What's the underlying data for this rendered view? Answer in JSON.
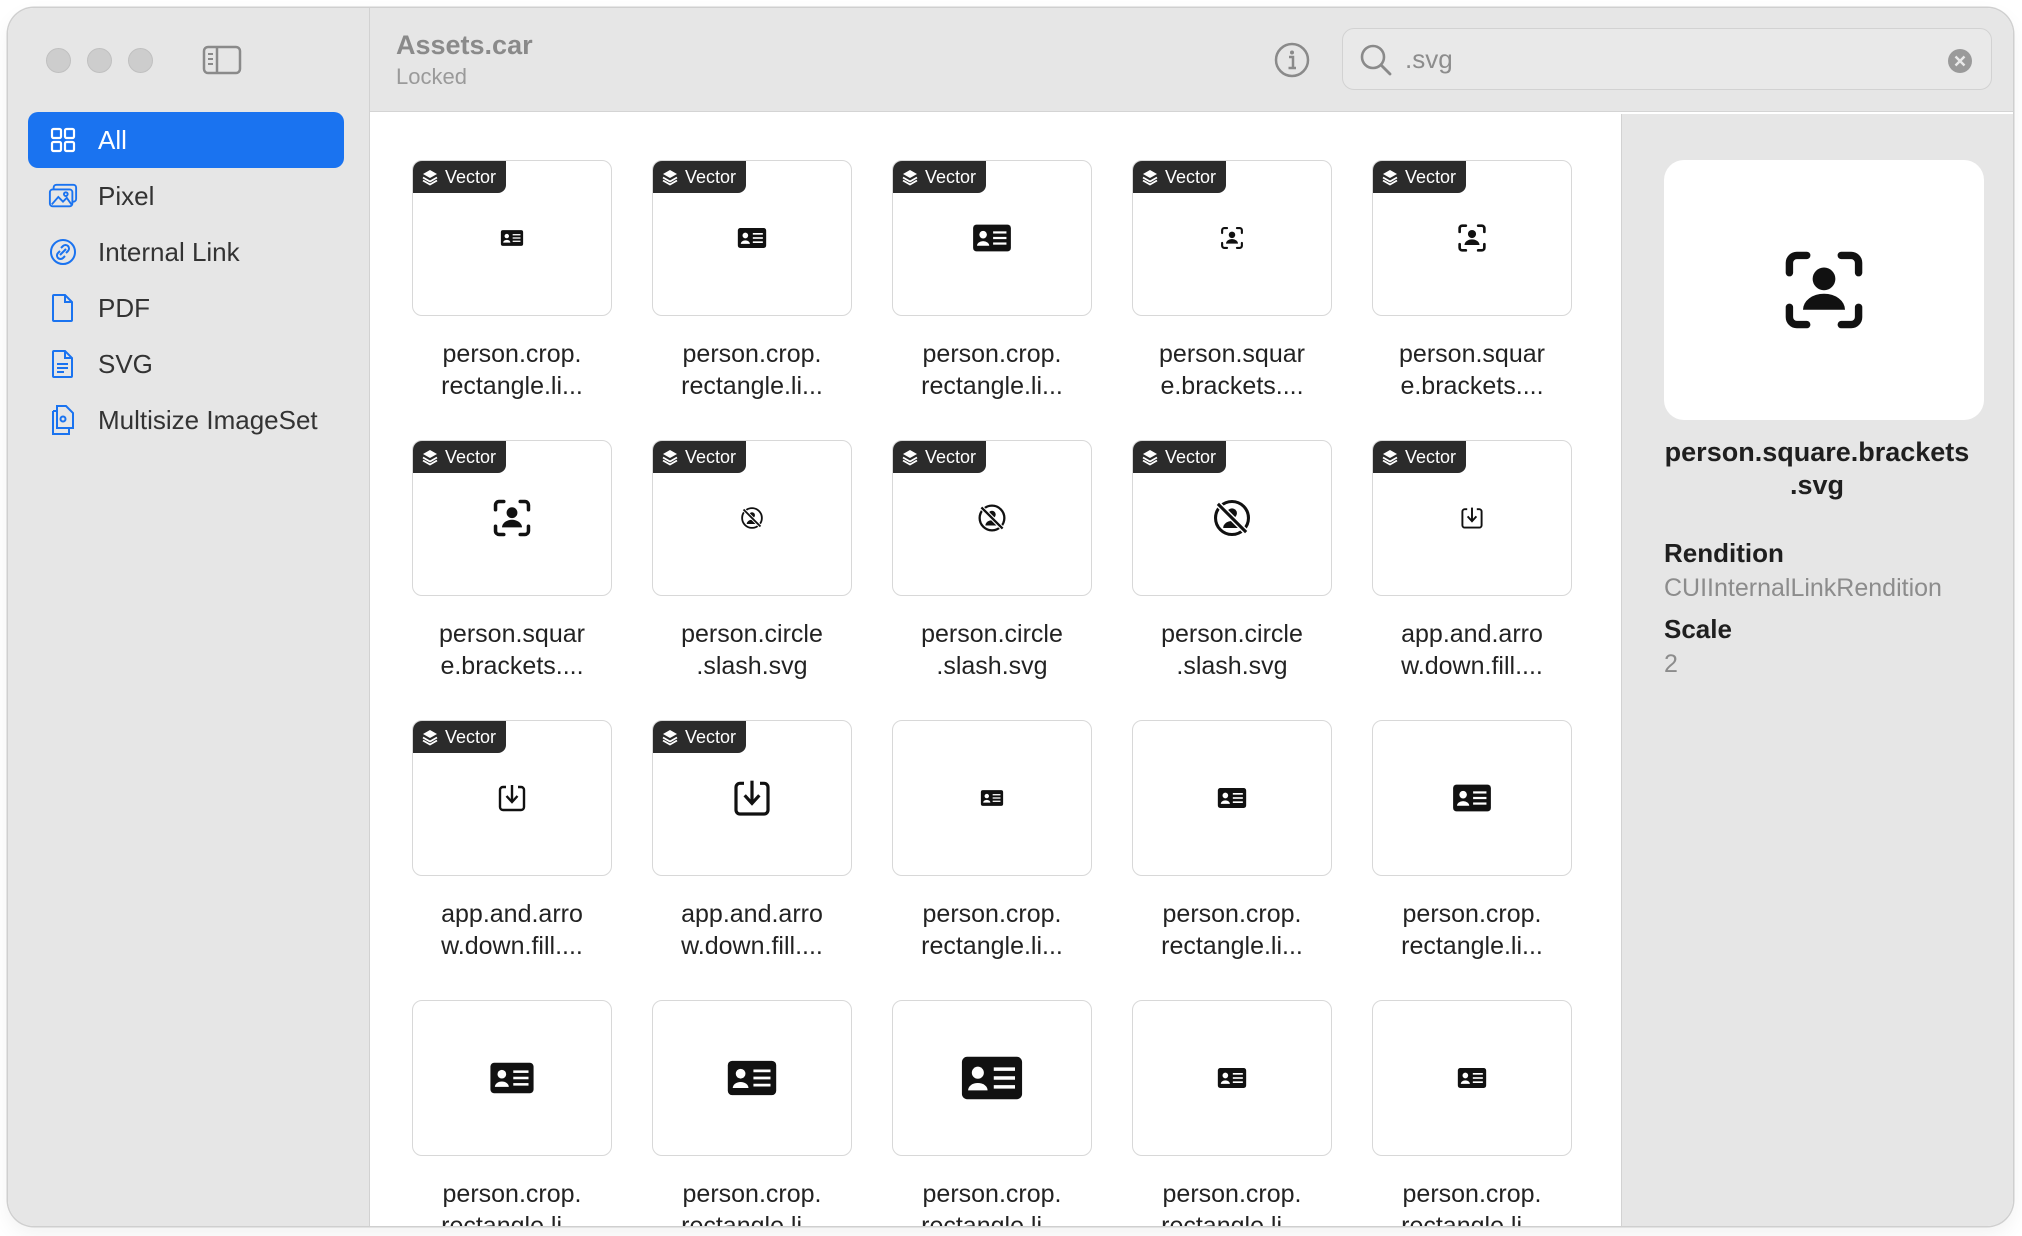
{
  "window": {
    "title": "Assets.car",
    "subtitle": "Locked"
  },
  "sidebar": {
    "items": [
      {
        "label": "All",
        "icon": "grid-icon",
        "active": true
      },
      {
        "label": "Pixel",
        "icon": "photos-icon",
        "active": false
      },
      {
        "label": "Internal Link",
        "icon": "link-icon",
        "active": false
      },
      {
        "label": "PDF",
        "icon": "document-icon",
        "active": false
      },
      {
        "label": "SVG",
        "icon": "document-text-icon",
        "active": false
      },
      {
        "label": "Multisize ImageSet",
        "icon": "documents-stack-icon",
        "active": false
      }
    ]
  },
  "search": {
    "value": ".svg",
    "placeholder": "Search"
  },
  "badge_label": "Vector",
  "assets": [
    {
      "label": "person.crop.\nrectangle.li...",
      "vector": true,
      "icon": "person-card-icon",
      "size": "xs"
    },
    {
      "label": "person.crop.\nrectangle.li...",
      "vector": true,
      "icon": "person-card-icon",
      "size": "s"
    },
    {
      "label": "person.crop.\nrectangle.li...",
      "vector": true,
      "icon": "person-card-icon",
      "size": "m"
    },
    {
      "label": "person.squar\ne.brackets....",
      "vector": true,
      "icon": "person-brackets-icon",
      "size": "xs"
    },
    {
      "label": "person.squar\ne.brackets....",
      "vector": true,
      "icon": "person-brackets-icon",
      "size": "s"
    },
    {
      "label": "person.squar\ne.brackets....",
      "vector": true,
      "icon": "person-brackets-icon",
      "size": "m"
    },
    {
      "label": "person.circle\n.slash.svg",
      "vector": true,
      "icon": "person-circle-slash-icon",
      "size": "xs"
    },
    {
      "label": "person.circle\n.slash.svg",
      "vector": true,
      "icon": "person-circle-slash-icon",
      "size": "s"
    },
    {
      "label": "person.circle\n.slash.svg",
      "vector": true,
      "icon": "person-circle-slash-icon",
      "size": "m"
    },
    {
      "label": "app.and.arro\nw.down.fill....",
      "vector": true,
      "icon": "app-arrow-down-icon",
      "size": "xs"
    },
    {
      "label": "app.and.arro\nw.down.fill....",
      "vector": true,
      "icon": "app-arrow-down-icon",
      "size": "s"
    },
    {
      "label": "app.and.arro\nw.down.fill....",
      "vector": true,
      "icon": "app-arrow-down-icon",
      "size": "m"
    },
    {
      "label": "person.crop.\nrectangle.li...",
      "vector": false,
      "icon": "person-card-icon",
      "size": "xs"
    },
    {
      "label": "person.crop.\nrectangle.li...",
      "vector": false,
      "icon": "person-card-icon",
      "size": "s"
    },
    {
      "label": "person.crop.\nrectangle.li...",
      "vector": false,
      "icon": "person-card-icon",
      "size": "m"
    },
    {
      "label": "person.crop.\nrectangle.li...",
      "vector": false,
      "icon": "person-card-icon",
      "size": "l"
    },
    {
      "label": "person.crop.\nrectangle.li...",
      "vector": false,
      "icon": "person-card-icon",
      "size": "xl"
    },
    {
      "label": "person.crop.\nrectangle.li...",
      "vector": false,
      "icon": "person-card-icon",
      "size": "xxl"
    },
    {
      "label": "person.crop.\nrectangle.li...",
      "vector": false,
      "icon": "person-card-icon",
      "size": "s"
    },
    {
      "label": "person.crop.\nrectangle.li...",
      "vector": false,
      "icon": "person-card-icon",
      "size": "s"
    }
  ],
  "inspector": {
    "name": "person.square.brackets\n.svg",
    "preview_icon": "person-brackets-icon",
    "rendition_label": "Rendition",
    "rendition_value": "CUIInternalLinkRendition",
    "scale_label": "Scale",
    "scale_value": "2"
  },
  "colors": {
    "accent": "#1a73f0",
    "sidebar_bg": "#e6e6e6",
    "badge_bg": "#2b2b2b"
  }
}
